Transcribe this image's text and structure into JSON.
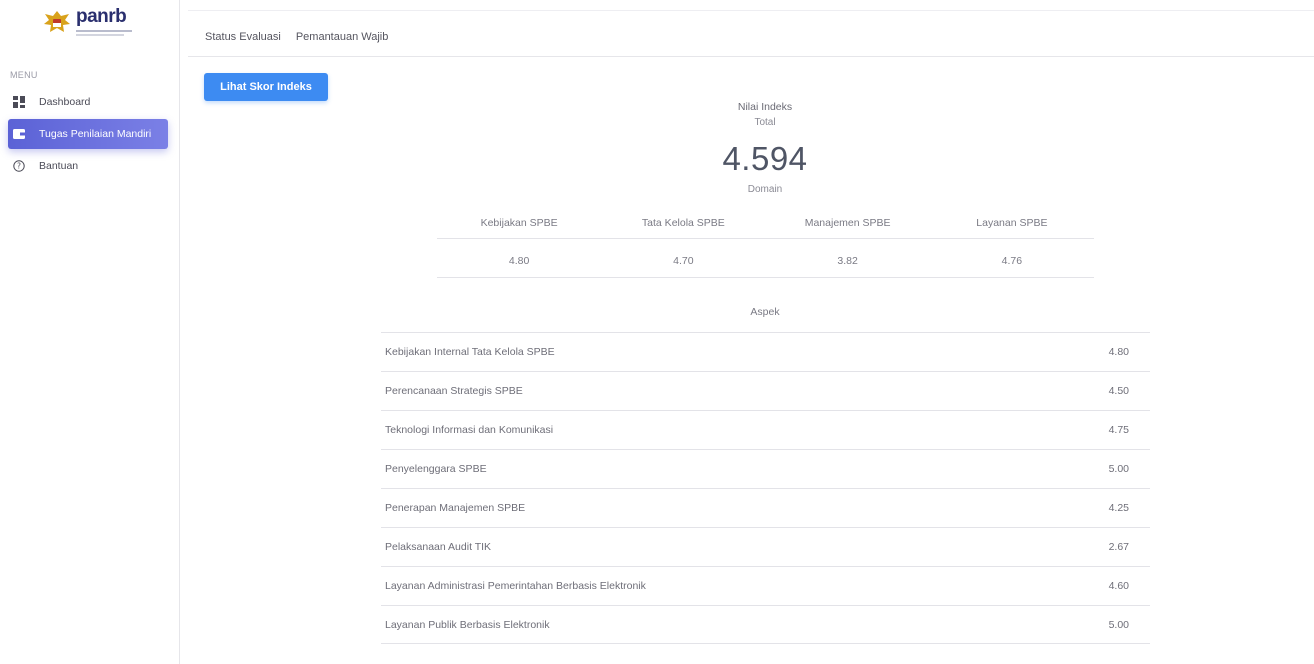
{
  "brand": {
    "name": "panrb"
  },
  "sidebar": {
    "heading": "MENU",
    "items": [
      {
        "label": "Dashboard",
        "icon": "dashboard-icon"
      },
      {
        "label": "Tugas Penilaian Mandiri",
        "icon": "wallet-icon",
        "active": true
      },
      {
        "label": "Bantuan",
        "icon": "help-icon"
      }
    ]
  },
  "tabs": [
    "Status Evaluasi",
    "Pemantauan Wajib"
  ],
  "actions": {
    "lihat_skor": "Lihat Skor Indeks"
  },
  "index": {
    "title": "Nilai Indeks",
    "subtitle": "Total",
    "value": "4.594",
    "domain_title": "Domain"
  },
  "domains": {
    "headers": [
      "Kebijakan SPBE",
      "Tata Kelola SPBE",
      "Manajemen SPBE",
      "Layanan SPBE"
    ],
    "values": [
      "4.80",
      "4.70",
      "3.82",
      "4.76"
    ]
  },
  "aspek": {
    "title": "Aspek",
    "rows": [
      {
        "name": "Kebijakan Internal Tata Kelola SPBE",
        "value": "4.80"
      },
      {
        "name": "Perencanaan Strategis SPBE",
        "value": "4.50"
      },
      {
        "name": "Teknologi Informasi dan Komunikasi",
        "value": "4.75"
      },
      {
        "name": "Penyelenggara SPBE",
        "value": "5.00"
      },
      {
        "name": "Penerapan Manajemen SPBE",
        "value": "4.25"
      },
      {
        "name": "Pelaksanaan Audit TIK",
        "value": "2.67"
      },
      {
        "name": "Layanan Administrasi Pemerintahan Berbasis Elektronik",
        "value": "4.60"
      },
      {
        "name": "Layanan Publik Berbasis Elektronik",
        "value": "5.00"
      }
    ]
  },
  "colors": {
    "accent": "#3d8bf2",
    "nav_active": "#5b62d6",
    "brand": "#2a2f6e"
  }
}
